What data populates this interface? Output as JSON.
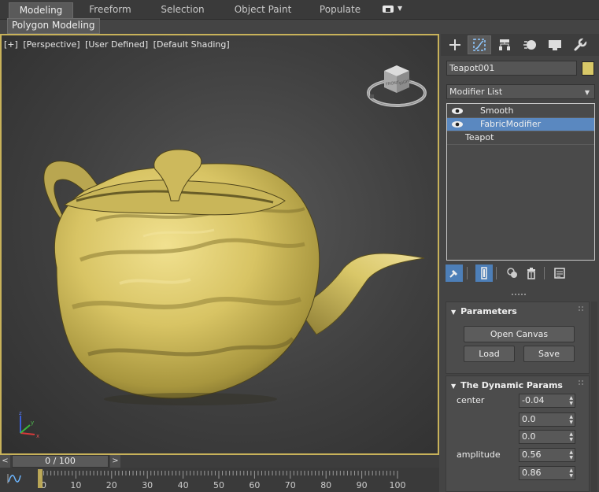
{
  "ribbon": {
    "tabs": [
      "Modeling",
      "Freeform",
      "Selection",
      "Object Paint",
      "Populate"
    ],
    "active_tab": "Modeling",
    "panel_label": "Polygon Modeling"
  },
  "viewport": {
    "labels": [
      "[+]",
      "[Perspective]",
      "[User Defined]",
      "[Default Shading]"
    ],
    "viewcube_faces": {
      "front": "FRONT",
      "right": "RIGHT"
    },
    "axes": {
      "x": "x",
      "y": "y",
      "z": "z"
    },
    "object_color": "#d8c868",
    "border_color": "#c8b25a"
  },
  "command_panel": {
    "tabs": [
      "create-icon",
      "modify-icon",
      "hierarchy-icon",
      "motion-icon",
      "display-icon",
      "utilities-icon"
    ],
    "object_name": "Teapot001",
    "object_color": "#d8c868",
    "modifier_list_label": "Modifier List",
    "stack": [
      {
        "label": "Smooth",
        "visible": true,
        "selected": false
      },
      {
        "label": "FabricModifier",
        "visible": true,
        "selected": true
      },
      {
        "label": "Teapot",
        "visible": false,
        "selected": false
      }
    ],
    "parameters": {
      "title": "Parameters",
      "open_canvas": "Open Canvas",
      "load": "Load",
      "save": "Save"
    },
    "dynamic_params": {
      "title": "The Dynamic Params",
      "center_label": "center",
      "center_values": [
        "-0.04",
        "0.0",
        "0.0"
      ],
      "amplitude_label": "amplitude",
      "amplitude_values": [
        "0.56",
        "0.86"
      ]
    }
  },
  "timeline": {
    "frame_display": "0 / 100",
    "prev": "<",
    "next": ">",
    "ticks": [
      "0",
      "10",
      "20",
      "30",
      "40",
      "50",
      "60",
      "70",
      "80",
      "90",
      "100"
    ]
  }
}
